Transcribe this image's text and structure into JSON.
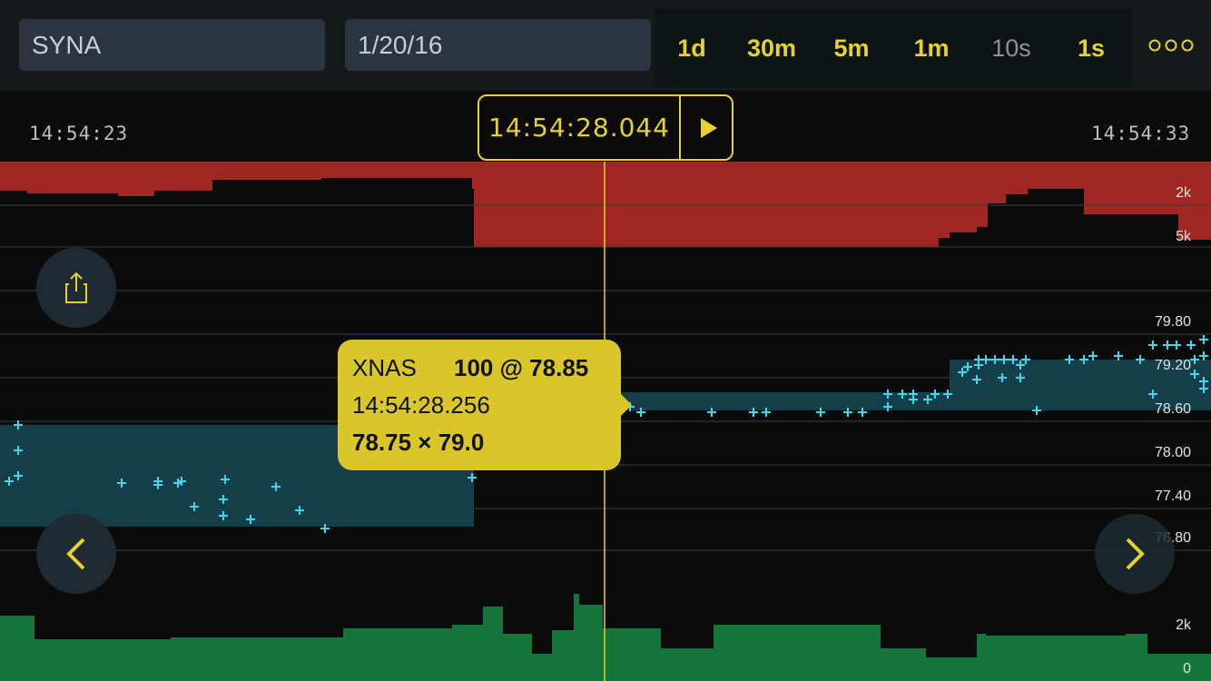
{
  "symbol": "SYNA",
  "date": "1/20/16",
  "intervals": [
    {
      "label": "1d",
      "active": true
    },
    {
      "label": "30m",
      "active": true
    },
    {
      "label": "5m",
      "active": true
    },
    {
      "label": "1m",
      "active": true
    },
    {
      "label": "10s",
      "active": false
    },
    {
      "label": "1s",
      "active": true
    }
  ],
  "more_icon": "more-dots-icon",
  "time_start": "14:54:23",
  "time_end": "14:54:33",
  "current_time": "14:54:28.044",
  "play_icon": "play-icon",
  "axis_labels": {
    "ask_size": [
      "2k",
      "5k"
    ],
    "price": [
      "79.80",
      "79.20",
      "78.60",
      "78.00",
      "77.40",
      "76.80"
    ],
    "bid_size": [
      "2k",
      "0"
    ]
  },
  "tooltip": {
    "venue": "XNAS",
    "trade": "100 @ 78.85",
    "time": "14:54:28.256",
    "quote": "78.75 × 79.0"
  },
  "buttons": {
    "share": "share-icon",
    "prev": "chevron-left-icon",
    "next": "chevron-right-icon"
  },
  "colors": {
    "accent": "#e6d22e",
    "ask": "#a02622",
    "bid": "#16753a",
    "spread": "#143f48",
    "trade": "#3fd8f0"
  }
}
